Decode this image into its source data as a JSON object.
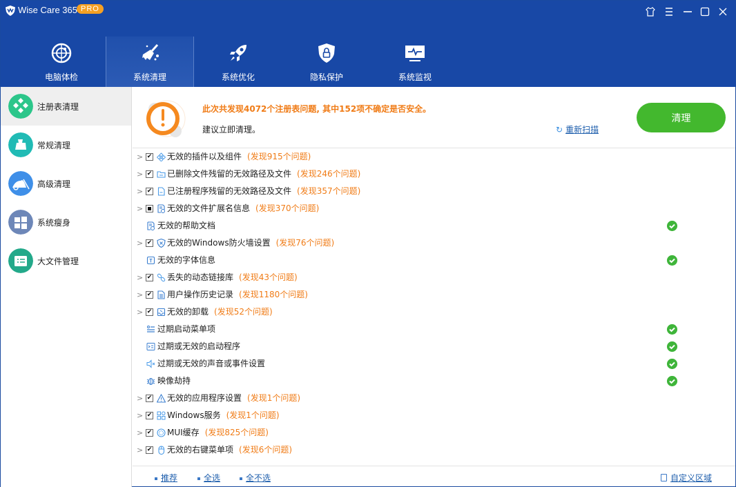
{
  "app": {
    "title": "Wise Care 365",
    "badge": "PRO"
  },
  "window_controls": [
    {
      "name": "skin-icon"
    },
    {
      "name": "menu-icon"
    },
    {
      "name": "minimize-icon"
    },
    {
      "name": "maximize-icon"
    },
    {
      "name": "close-icon"
    }
  ],
  "tabs": [
    {
      "label": "电脑体检",
      "icon": "radar-icon",
      "active": false
    },
    {
      "label": "系统清理",
      "icon": "broom-icon",
      "active": true
    },
    {
      "label": "系统优化",
      "icon": "rocket-icon",
      "active": false
    },
    {
      "label": "隐私保护",
      "icon": "shield-lock-icon",
      "active": false
    },
    {
      "label": "系统监视",
      "icon": "monitor-icon",
      "active": false
    }
  ],
  "sidebar": {
    "items": [
      {
        "label": "注册表清理",
        "icon": "registry-icon",
        "color": "#2cc68a",
        "active": true
      },
      {
        "label": "常规清理",
        "icon": "broom-icon",
        "color": "#21bbb5",
        "active": false
      },
      {
        "label": "高级清理",
        "icon": "vacuum-icon",
        "color": "#3f8fe8",
        "active": false
      },
      {
        "label": "系统瘦身",
        "icon": "windows-icon",
        "color": "#6d87b8",
        "active": false
      },
      {
        "label": "大文件管理",
        "icon": "file-list-icon",
        "color": "#23a98a",
        "active": false
      }
    ]
  },
  "banner": {
    "headline": "此次共发现4072个注册表问题, 其中152项不确定是否安全。",
    "subtext": "建议立即清理。",
    "rescan_label": "重新扫描",
    "clean_label": "清理",
    "accent": "#f07c17",
    "button_color": "#43b82e"
  },
  "items": [
    {
      "label": "无效的插件以及组件",
      "count": "(发现915个问题)",
      "icon": "plugin-icon",
      "expandable": true,
      "checked": "checked"
    },
    {
      "label": "已删除文件残留的无效路径及文件",
      "count": "(发现246个问题)",
      "icon": "folder-icon",
      "expandable": true,
      "checked": "checked"
    },
    {
      "label": "已注册程序残留的无效路径及文件",
      "count": "(发现357个问题)",
      "icon": "file-icon",
      "expandable": true,
      "checked": "checked"
    },
    {
      "label": "无效的文件扩展名信息",
      "count": "(发现370个问题)",
      "icon": "file-ext-icon",
      "expandable": true,
      "checked": "partial"
    },
    {
      "label": "无效的帮助文档",
      "count": "",
      "icon": "help-doc-icon",
      "expandable": false,
      "ok": true
    },
    {
      "label": "无效的Windows防火墙设置",
      "count": "(发现76个问题)",
      "icon": "firewall-icon",
      "expandable": true,
      "checked": "checked"
    },
    {
      "label": "无效的字体信息",
      "count": "",
      "icon": "font-icon",
      "expandable": false,
      "ok": true
    },
    {
      "label": "丢失的动态链接库",
      "count": "(发现43个问题)",
      "icon": "link-icon",
      "expandable": true,
      "checked": "checked"
    },
    {
      "label": "用户操作历史记录",
      "count": "(发现1180个问题)",
      "icon": "history-icon",
      "expandable": true,
      "checked": "checked"
    },
    {
      "label": "无效的卸载",
      "count": "(发现52个问题)",
      "icon": "uninstall-icon",
      "expandable": true,
      "checked": "checked"
    },
    {
      "label": "过期启动菜单项",
      "count": "",
      "icon": "start-menu-icon",
      "expandable": false,
      "ok": true
    },
    {
      "label": "过期或无效的启动程序",
      "count": "",
      "icon": "startup-icon",
      "expandable": false,
      "ok": true
    },
    {
      "label": "过期或无效的声音或事件设置",
      "count": "",
      "icon": "sound-icon",
      "expandable": false,
      "ok": true
    },
    {
      "label": "映像劫持",
      "count": "",
      "icon": "bug-icon",
      "expandable": false,
      "ok": true
    },
    {
      "label": "无效的应用程序设置",
      "count": "(发现1个问题)",
      "icon": "warning-icon",
      "expandable": true,
      "checked": "checked"
    },
    {
      "label": "Windows服务",
      "count": "(发现1个问题)",
      "icon": "services-icon",
      "expandable": true,
      "checked": "checked"
    },
    {
      "label": "MUI缓存",
      "count": "(发现825个问题)",
      "icon": "mui-icon",
      "expandable": true,
      "checked": "checked"
    },
    {
      "label": "无效的右键菜单项",
      "count": "(发现6个问题)",
      "icon": "mouse-icon",
      "expandable": true,
      "checked": "checked"
    }
  ],
  "footer": {
    "recommend": "推荐",
    "select_all": "全选",
    "select_none": "全不选",
    "custom_area": "自定义区域"
  }
}
